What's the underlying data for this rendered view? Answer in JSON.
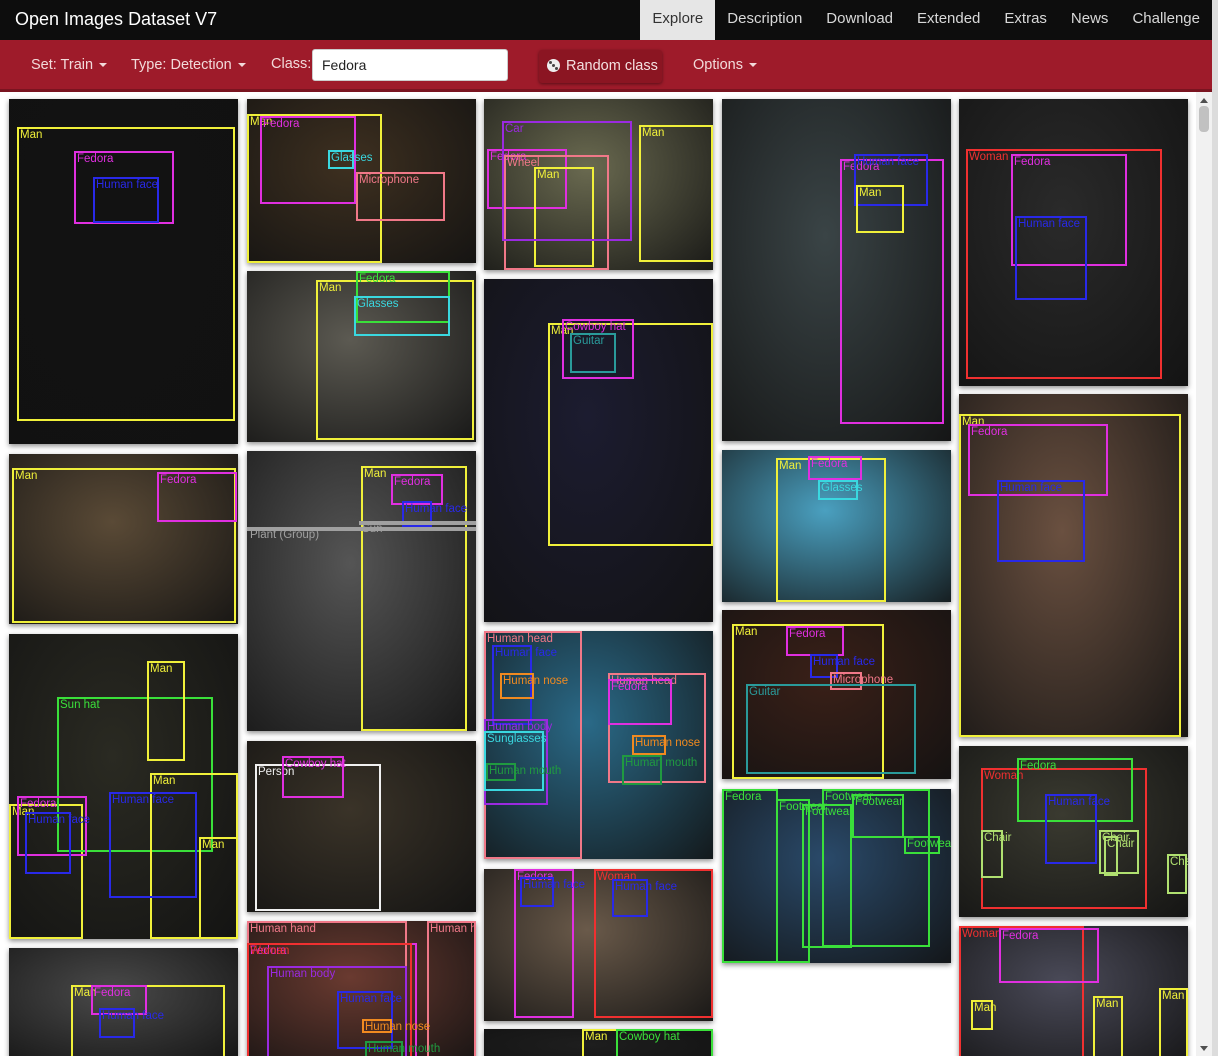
{
  "app": {
    "title": "Open Images Dataset V7",
    "nav": [
      "Explore",
      "Description",
      "Download",
      "Extended",
      "Extras",
      "News",
      "Challenge"
    ],
    "active_nav": "Explore"
  },
  "toolbar": {
    "set_label": "Set: Train",
    "type_label": "Type: Detection",
    "class_label": "Class:",
    "class_value": "Fedora",
    "random_button": "Random class",
    "options_label": "Options"
  },
  "colors": {
    "toolbar": "#9e1b2a",
    "topbar": "#0d0d0d",
    "yellow": "#f0f03a",
    "magenta": "#e02fe0",
    "blue": "#2929e8",
    "cyan": "#3ad8e0",
    "salmon": "#f07888",
    "green": "#3ae03a",
    "red": "#f03030",
    "teal": "#2a9a9a",
    "purple": "#9a2ae0",
    "olive": "#b0e070",
    "white": "#f0f0f0",
    "orange": "#f08a20",
    "darkgreen": "#209a40",
    "gray": "#a0a0a0"
  },
  "thumbnails": [
    {
      "id": "t1",
      "bg": "#121212",
      "labels": [
        {
          "text": "Man",
          "color": "yellow"
        },
        {
          "text": "Fedora",
          "color": "magenta"
        },
        {
          "text": "Human face",
          "color": "blue"
        }
      ]
    },
    {
      "id": "t2",
      "bg": "#5a4a36",
      "labels": [
        {
          "text": "Man",
          "color": "yellow"
        },
        {
          "text": "Fedora",
          "color": "magenta"
        }
      ]
    },
    {
      "id": "t3",
      "bg": "#2a2a22",
      "labels": [
        {
          "text": "Man",
          "color": "yellow"
        },
        {
          "text": "Sun hat",
          "color": "green"
        },
        {
          "text": "Man",
          "color": "yellow"
        },
        {
          "text": "Man",
          "color": "yellow"
        },
        {
          "text": "Man",
          "color": "yellow"
        },
        {
          "text": "Fedora",
          "color": "magenta"
        },
        {
          "text": "Human face",
          "color": "blue"
        },
        {
          "text": "Human face",
          "color": "blue"
        }
      ]
    },
    {
      "id": "t4",
      "bg": "#4a4a4a",
      "labels": [
        {
          "text": "Man",
          "color": "yellow"
        },
        {
          "text": "Fedora",
          "color": "magenta"
        },
        {
          "text": "Human face",
          "color": "blue"
        }
      ]
    },
    {
      "id": "t5",
      "bg": "#3e3020",
      "labels": [
        {
          "text": "Man",
          "color": "yellow"
        },
        {
          "text": "Fedora",
          "color": "magenta"
        },
        {
          "text": "Glasses",
          "color": "cyan"
        },
        {
          "text": "Microphone",
          "color": "salmon"
        }
      ]
    },
    {
      "id": "t6",
      "bg": "#5c5a52",
      "labels": [
        {
          "text": "Man",
          "color": "yellow"
        },
        {
          "text": "Fedora",
          "color": "green"
        },
        {
          "text": "Glasses",
          "color": "cyan"
        }
      ]
    },
    {
      "id": "t7",
      "bg": "#555555",
      "labels": [
        {
          "text": "Man",
          "color": "yellow"
        },
        {
          "text": "Fedora",
          "color": "magenta"
        },
        {
          "text": "Human face",
          "color": "blue"
        },
        {
          "text": "Plant (Group)",
          "color": "gray"
        },
        {
          "text": "Sun",
          "color": "gray"
        }
      ]
    },
    {
      "id": "t8",
      "bg": "#3a3328",
      "labels": [
        {
          "text": "Person",
          "color": "white"
        },
        {
          "text": "Cowboy hat",
          "color": "magenta"
        }
      ]
    },
    {
      "id": "t9",
      "bg": "#6a3a30",
      "labels": [
        {
          "text": "Human hand",
          "color": "salmon"
        },
        {
          "text": "Human hand",
          "color": "salmon"
        },
        {
          "text": "Fedora",
          "color": "magenta"
        },
        {
          "text": "Woman",
          "color": "red"
        },
        {
          "text": "Human body",
          "color": "purple"
        },
        {
          "text": "Human face",
          "color": "blue"
        },
        {
          "text": "Human nose",
          "color": "orange"
        },
        {
          "text": "Human mouth",
          "color": "darkgreen"
        }
      ]
    },
    {
      "id": "t10",
      "bg": "#6a6a50",
      "labels": [
        {
          "text": "Fedora",
          "color": "magenta"
        },
        {
          "text": "Wheel",
          "color": "salmon"
        },
        {
          "text": "Man",
          "color": "yellow"
        },
        {
          "text": "Man",
          "color": "yellow"
        },
        {
          "text": "Car",
          "color": "purple"
        }
      ]
    },
    {
      "id": "t11",
      "bg": "#1c1c30",
      "labels": [
        {
          "text": "Man",
          "color": "yellow"
        },
        {
          "text": "Cowboy hat",
          "color": "magenta"
        },
        {
          "text": "Guitar",
          "color": "teal"
        }
      ]
    },
    {
      "id": "t12",
      "bg": "#2a6a88",
      "labels": [
        {
          "text": "Human head",
          "color": "salmon"
        },
        {
          "text": "Human face",
          "color": "blue"
        },
        {
          "text": "Human nose",
          "color": "orange"
        },
        {
          "text": "Human body",
          "color": "purple"
        },
        {
          "text": "Sunglasses",
          "color": "cyan"
        },
        {
          "text": "Human mouth",
          "color": "darkgreen"
        },
        {
          "text": "Human head",
          "color": "salmon"
        },
        {
          "text": "Fedora",
          "color": "magenta"
        },
        {
          "text": "Human nose",
          "color": "orange"
        },
        {
          "text": "Human mouth",
          "color": "darkgreen"
        }
      ]
    },
    {
      "id": "t13",
      "bg": "#6a5a4a",
      "labels": [
        {
          "text": "Fedora",
          "color": "magenta"
        },
        {
          "text": "Woman",
          "color": "red"
        },
        {
          "text": "Human face",
          "color": "blue"
        },
        {
          "text": "Human face",
          "color": "blue"
        }
      ]
    },
    {
      "id": "t14",
      "bg": "#1e1e1e",
      "labels": [
        {
          "text": "Man",
          "color": "yellow"
        },
        {
          "text": "Cowboy hat",
          "color": "green"
        }
      ]
    },
    {
      "id": "t15",
      "bg": "#3a4446",
      "labels": [
        {
          "text": "Fedora",
          "color": "magenta"
        },
        {
          "text": "Human face",
          "color": "blue"
        },
        {
          "text": "Man",
          "color": "yellow"
        }
      ]
    },
    {
      "id": "t16",
      "bg": "#4aa0c0",
      "labels": [
        {
          "text": "Man",
          "color": "yellow"
        },
        {
          "text": "Fedora",
          "color": "magenta"
        },
        {
          "text": "Glasses",
          "color": "cyan"
        }
      ]
    },
    {
      "id": "t17",
      "bg": "#3a2018",
      "labels": [
        {
          "text": "Man",
          "color": "yellow"
        },
        {
          "text": "Fedora",
          "color": "magenta"
        },
        {
          "text": "Human face",
          "color": "blue"
        },
        {
          "text": "Microphone",
          "color": "salmon"
        },
        {
          "text": "Guitar",
          "color": "teal"
        }
      ]
    },
    {
      "id": "t18",
      "bg": "#2a4a6a",
      "labels": [
        {
          "text": "Fedora",
          "color": "green"
        },
        {
          "text": "Footwear",
          "color": "green"
        },
        {
          "text": "Footwear",
          "color": "green"
        },
        {
          "text": "Footwear",
          "color": "green"
        },
        {
          "text": "Footwear",
          "color": "green"
        },
        {
          "text": "Footwear",
          "color": "green"
        }
      ]
    },
    {
      "id": "t19",
      "bg": "#2a2a2a",
      "labels": [
        {
          "text": "Woman",
          "color": "red"
        },
        {
          "text": "Fedora",
          "color": "magenta"
        },
        {
          "text": "Human face",
          "color": "blue"
        }
      ]
    },
    {
      "id": "t20",
      "bg": "#6a5040",
      "labels": [
        {
          "text": "Man",
          "color": "yellow"
        },
        {
          "text": "Fedora",
          "color": "magenta"
        },
        {
          "text": "Human face",
          "color": "blue"
        }
      ]
    },
    {
      "id": "t21",
      "bg": "#3a3a30",
      "labels": [
        {
          "text": "Woman",
          "color": "red"
        },
        {
          "text": "Fedora",
          "color": "green"
        },
        {
          "text": "Human face",
          "color": "blue"
        },
        {
          "text": "Chair",
          "color": "olive"
        },
        {
          "text": "Chair",
          "color": "olive"
        },
        {
          "text": "Chair",
          "color": "olive"
        },
        {
          "text": "Chair",
          "color": "olive"
        }
      ]
    },
    {
      "id": "t22",
      "bg": "#4a4a58",
      "labels": [
        {
          "text": "Woman",
          "color": "red"
        },
        {
          "text": "Fedora",
          "color": "magenta"
        },
        {
          "text": "Man",
          "color": "yellow"
        },
        {
          "text": "Man",
          "color": "yellow"
        },
        {
          "text": "Man",
          "color": "yellow"
        }
      ]
    }
  ]
}
